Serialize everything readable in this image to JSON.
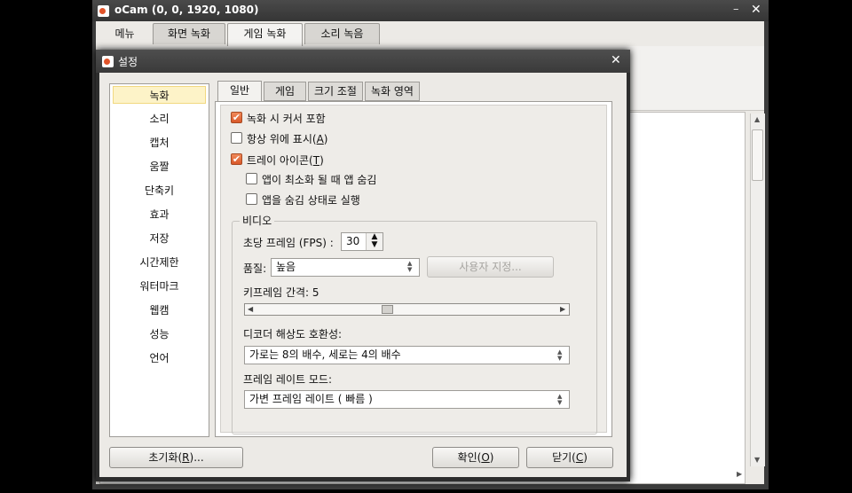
{
  "main_window": {
    "title": "oCam (0, 0, 1920, 1080)",
    "min_symbol": "–",
    "close_symbol": "✕",
    "tabs": [
      "메뉴",
      "화면 녹화",
      "게임 녹화",
      "소리 녹음"
    ],
    "active_tab": "게임 녹화"
  },
  "dialog": {
    "title": "설정",
    "close_symbol": "✕",
    "sidebar": [
      "녹화",
      "소리",
      "캡처",
      "움짤",
      "단축키",
      "효과",
      "저장",
      "시간제한",
      "워터마크",
      "웹캠",
      "성능",
      "언어"
    ],
    "sidebar_selected": "녹화",
    "tabs": [
      "일반",
      "게임",
      "크기 조절",
      "녹화 영역"
    ],
    "active_tab": "일반",
    "options": {
      "include_cursor": {
        "label": "녹화 시 커서 포함",
        "checked": true
      },
      "always_on_top": {
        "label": "항상 위에 표시(",
        "key": "A",
        "checked": false
      },
      "tray_icon": {
        "label": "트레이 아이콘(",
        "key": "T",
        "checked": true
      },
      "hide_on_minimize": {
        "label": "앱이 최소화 될 때 앱 숨김",
        "checked": false
      },
      "run_hidden": {
        "label": "앱을 숨김 상태로 실행",
        "checked": false
      }
    },
    "video": {
      "group_label": "비디오",
      "fps_label": "초당 프레임 (FPS) :",
      "fps_value": "30",
      "quality_label": "품질:",
      "quality_value": "높음",
      "custom_button": "사용자 지정...",
      "keyframe_label": "키프레임 간격: 5",
      "keyframe_value_fraction": 0.43,
      "decoder_label": "디코더 해상도 호환성:",
      "decoder_value": "가로는 8의 배수, 세로는 4의 배수",
      "framerate_mode_label": "프레임 레이트 모드:",
      "framerate_mode_value": "가변 프레임 레이트 ( 빠름 )"
    },
    "buttons": {
      "reset": "초기화(",
      "reset_key": "R",
      "reset_tail": ")...",
      "ok": "확인(",
      "ok_key": "O",
      "close": "닫기(",
      "close_key": "C",
      "tail": ")"
    }
  }
}
